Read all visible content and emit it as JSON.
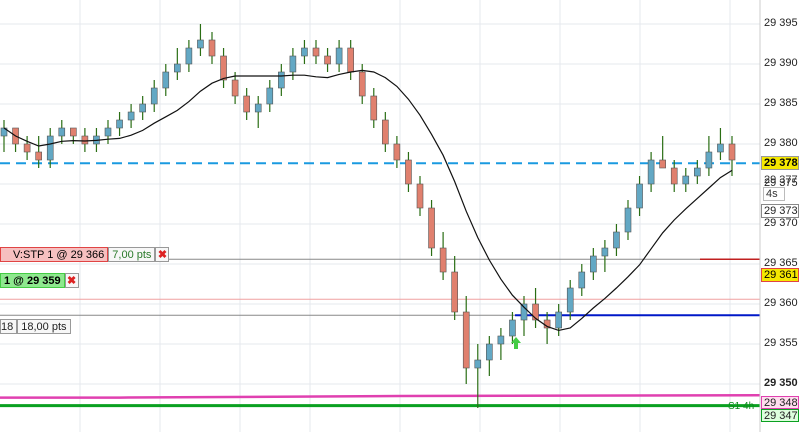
{
  "instrument_chart": {
    "price_axis": {
      "labels": [
        "29 395",
        "29 390",
        "29 385",
        "29 380",
        "29 375",
        "29 370",
        "29 365",
        "29 360",
        "29 355",
        "29 350"
      ],
      "range": [
        29344,
        29398
      ]
    },
    "current_price": {
      "value": "29 378",
      "bg": "#f5e800",
      "border": "#999"
    },
    "price_tags": [
      {
        "id": "tag-29377",
        "text": "29 377"
      },
      {
        "id": "tag-4s",
        "text": "4s"
      },
      {
        "id": "tag-29373",
        "text": "29 373"
      },
      {
        "id": "tag-29361",
        "text": "29 361"
      },
      {
        "id": "tag-29348",
        "text": "29 348"
      },
      {
        "id": "tag-29347",
        "text": "29 347"
      },
      {
        "id": "tag-s14h",
        "text": "S1 4h"
      }
    ],
    "stop_order": {
      "label": "V:STP  1 @ 29 366",
      "pts": "7,00 pts",
      "color": "#e04444"
    },
    "limit_order": {
      "label": "1 @ 29 359",
      "prefix": "18",
      "pts": "18,00 pts",
      "color": "#44cc44"
    },
    "colors": {
      "bull": "#63a8c4",
      "bear": "#e0806e",
      "wick": "#2a6e14",
      "ma": "#111111",
      "dash": "#1a9ae0",
      "support": "#0aa020",
      "pivot": "#e040b0",
      "target": "#0018c8"
    }
  }
}
